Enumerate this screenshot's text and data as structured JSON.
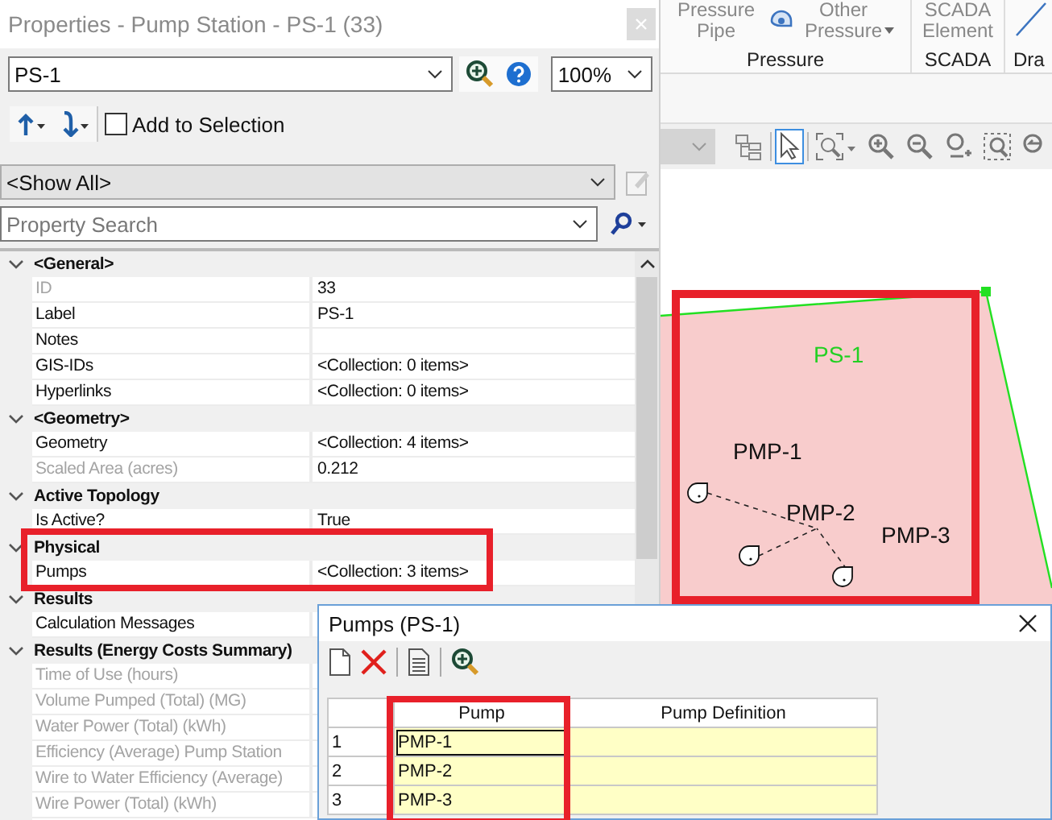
{
  "properties_panel": {
    "title": "Properties - Pump Station - PS-1 (33)",
    "element_combo": {
      "value": "PS-1"
    },
    "zoom_combo": {
      "value": "100%"
    },
    "add_to_selection": {
      "label": "Add to Selection",
      "checked": false
    },
    "filter_combo": {
      "value": "<Show All>"
    },
    "search": {
      "placeholder": "Property Search"
    },
    "categories": [
      {
        "label": "<General>",
        "expanded": true,
        "children": [
          {
            "label": "ID",
            "value": "33",
            "readonly": true
          },
          {
            "label": "Label",
            "value": "PS-1",
            "readonly": false
          },
          {
            "label": "Notes",
            "readonly": false
          },
          {
            "label": "GIS-IDs",
            "value": "<Collection: 0 items>",
            "readonly": false
          },
          {
            "label": "Hyperlinks",
            "value": "<Collection: 0 items>",
            "readonly": false
          }
        ]
      },
      {
        "label": "<Geometry>",
        "expanded": true,
        "children": [
          {
            "label": "Geometry",
            "value": "<Collection: 4 items>",
            "readonly": false
          },
          {
            "label": "Scaled Area (acres)",
            "value": "0.212",
            "readonly": true
          }
        ]
      },
      {
        "label": "Active Topology",
        "expanded": true,
        "children": [
          {
            "label": "Is Active?",
            "value": "True",
            "readonly": false
          }
        ]
      },
      {
        "label": "Physical",
        "expanded": true,
        "children": [
          {
            "label": "Pumps",
            "value": "<Collection: 3 items>",
            "readonly": false
          }
        ]
      },
      {
        "label": "Results",
        "expanded": true,
        "children": [
          {
            "label": "Calculation Messages",
            "readonly": false
          }
        ]
      },
      {
        "label": "Results (Energy Costs Summary)",
        "expanded": true,
        "children": [
          {
            "label": "Time of Use (hours)",
            "readonly": true
          },
          {
            "label": "Volume Pumped (Total) (MG)",
            "readonly": true
          },
          {
            "label": "Water Power (Total) (kWh)",
            "readonly": true
          },
          {
            "label": "Efficiency (Average) Pump Station",
            "readonly": true
          },
          {
            "label": "Wire to Water Efficiency (Average)",
            "readonly": true
          },
          {
            "label": "Wire Power (Total) (kWh)",
            "readonly": true
          }
        ]
      }
    ]
  },
  "ribbon": {
    "groups": [
      {
        "label": "Pressure",
        "buttons": [
          {
            "label": "Pressure Pipe",
            "kind": "text",
            "dropdown": false
          },
          {
            "label": "Other Pressure",
            "kind": "icon-text",
            "dropdown": true
          }
        ]
      },
      {
        "label": "SCADA",
        "buttons": [
          {
            "label": "SCADA Element",
            "kind": "text",
            "dropdown": false
          }
        ]
      },
      {
        "label": "Dra",
        "buttons": [
          {
            "kind": "icon",
            "dropdown": false
          }
        ]
      }
    ]
  },
  "toolbar": {
    "tools": [
      {
        "kind": "tree",
        "selected": false
      },
      {
        "kind": "pointer",
        "selected": true
      },
      {
        "kind": "zoom-extents",
        "selected": false
      },
      {
        "kind": "zoom-in",
        "selected": false
      },
      {
        "kind": "zoom-out",
        "selected": false
      },
      {
        "kind": "zoom-plus",
        "selected": false
      },
      {
        "kind": "zoom-window",
        "selected": false
      },
      {
        "kind": "zoom-previous",
        "selected": false
      }
    ]
  },
  "canvas": {
    "labels": [
      {
        "text": "PS-1",
        "kind": "station"
      },
      {
        "text": "PMP-1",
        "kind": "pump"
      },
      {
        "text": "PMP-2",
        "kind": "pump"
      },
      {
        "text": "PMP-3",
        "kind": "pump"
      }
    ]
  },
  "dialog": {
    "title": "Pumps (PS-1)",
    "columns": [
      "Pump",
      "Pump Definition"
    ],
    "rows": [
      {
        "number": "1",
        "pump": "PMP-1",
        "focused": true
      },
      {
        "number": "2",
        "pump": "PMP-2",
        "focused": false
      },
      {
        "number": "3",
        "pump": "PMP-3",
        "focused": false
      }
    ]
  }
}
